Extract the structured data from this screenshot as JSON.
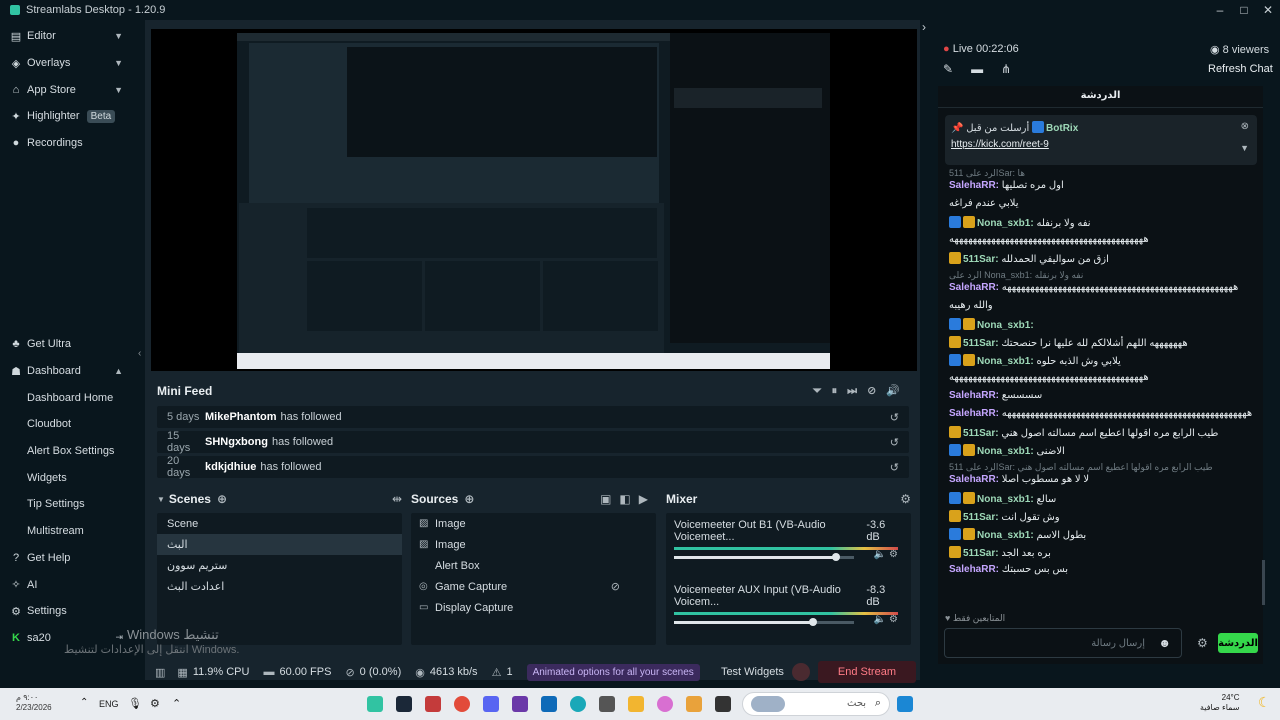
{
  "app": {
    "title": "Streamlabs Desktop - 1.20.9"
  },
  "window": {
    "minimize": "–",
    "maximize": "□",
    "close": "✕"
  },
  "sidebar": {
    "top": [
      {
        "label": "Editor",
        "icon": "editor-icon"
      },
      {
        "label": "Overlays",
        "icon": "overlays-icon"
      },
      {
        "label": "App Store",
        "icon": "app-store-icon"
      },
      {
        "label": "Highlighter",
        "icon": "highlighter-icon",
        "badge": "Beta"
      },
      {
        "label": "Recordings",
        "icon": "recordings-icon"
      }
    ],
    "bottom": [
      {
        "label": "Get Ultra"
      },
      {
        "label": "Dashboard"
      },
      {
        "label": "Dashboard Home"
      },
      {
        "label": "Cloudbot"
      },
      {
        "label": "Alert Box Settings"
      },
      {
        "label": "Widgets"
      },
      {
        "label": "Tip Settings"
      },
      {
        "label": "Multistream"
      },
      {
        "label": "Get Help"
      },
      {
        "label": "AI"
      },
      {
        "label": "Settings"
      },
      {
        "label": "sa20"
      }
    ]
  },
  "minifeed": {
    "title": "Mini Feed",
    "rows": [
      {
        "days": "5 days",
        "name": "MikePhantom",
        "text": "has followed"
      },
      {
        "days": "15 days",
        "name": "SHNgxbong",
        "text": "has followed"
      },
      {
        "days": "20 days",
        "name": "kdkjdhiue",
        "text": "has followed"
      }
    ]
  },
  "scenes": {
    "title": "Scenes",
    "items": [
      "Scene",
      "البث",
      "ستريم سوون",
      "اعدادت البث"
    ],
    "selected": 1
  },
  "sources": {
    "title": "Sources",
    "items": [
      "Image",
      "Image",
      "Alert Box",
      "Game Capture",
      "Display Capture"
    ]
  },
  "mixer": {
    "title": "Mixer",
    "items": [
      {
        "name": "Voicemeeter Out B1 (VB-Audio Voicemeet...",
        "db": "-3.6 dB",
        "level": 0.9
      },
      {
        "name": "Voicemeeter AUX Input (VB-Audio Voicem...",
        "db": "-8.3 dB",
        "level": 0.77
      }
    ]
  },
  "footer": {
    "cpu": "11.9% CPU",
    "fps": "60.00 FPS",
    "dropped": "0 (0.0%)",
    "bitrate": "4613 kb/s",
    "alerts": "1",
    "animated": "Animated options for all your scenes",
    "test_widgets": "Test Widgets",
    "end_stream": "End Stream"
  },
  "chat": {
    "live": "Live 00:22:06",
    "viewers": "8 viewers",
    "refresh": "Refresh Chat",
    "tab": "الدردشة",
    "pinned_by": "أرسلت من قبل",
    "pinned_user": "BotRix",
    "pinned_link": "https://kick.com/reet-9",
    "messages": [
      {
        "reply": "الرد على 511Sar: ها"
      },
      {
        "user": "SalehaRR:",
        "text": "اول مره تصليها"
      },
      {
        "text": "يلابي عندم فراغه"
      },
      {
        "user": "Nona_sxb1:",
        "text": "نفه ولا برنفله",
        "badges": 1
      },
      {
        "text": "ههههههههههههههههههههههههههههههههههههههههههه"
      },
      {
        "user": "511Sar:",
        "text": "ازق من سواليفي الحمدلله",
        "gold": 1
      },
      {
        "reply": "الرد على Nona_sxb1: نفه ولا برنقله"
      },
      {
        "user": "SalehaRR:",
        "text": "ههههههههههههههههههههههههههههههههههههههههههههههههههه"
      },
      {
        "text": "والله رهيبه"
      },
      {
        "user": "Nona_sxb1:",
        "text": "",
        "badges": 1
      },
      {
        "user": "511Sar:",
        "text": "هههههههه اللهم أشلالكم لله عليها نرا حنصحتك",
        "gold": 1
      },
      {
        "user": "Nona_sxb1:",
        "text": "يلابي وش الذبه حلوه",
        "badges": 1
      },
      {
        "text": "ههههههههههههههههههههههههههههههههههههههههههه"
      },
      {
        "user": "SalehaRR:",
        "text": "سسسسع"
      },
      {
        "user": "SalehaRR:",
        "text": "هههههههههههههههههههههههههههههههههههههههههههههههههههههه"
      },
      {
        "user": "511Sar:",
        "text": "طيب الرابع مره اقولها اعطيع اسم مسالته اصول هني",
        "gold": 1
      },
      {
        "user": "Nona_sxb1:",
        "text": "الاضنى",
        "badges": 1
      },
      {
        "reply": "الرد على 511Sar: طيب الرابع مره اقولها اعطيع اسم مسالته اصول هني"
      },
      {
        "user": "SalehaRR:",
        "text": "لا لا هو مسطوب أصلا"
      },
      {
        "user": "Nona_sxb1:",
        "text": "سالع",
        "badges": 1
      },
      {
        "user": "511Sar:",
        "text": "وش تقول انت",
        "gold": 1
      },
      {
        "user": "Nona_sxb1:",
        "text": "بطول الاسم",
        "badges": 1
      },
      {
        "user": "511Sar:",
        "text": "بره بعد الجد",
        "gold": 1
      },
      {
        "user": "SalehaRR:",
        "text": "بس بس حسبتك"
      }
    ],
    "chatters": "المتابعين فقط",
    "input_placeholder": "إرسال رسالة",
    "send": "الدردشة"
  },
  "windows_watermark": {
    "line1": "Windows تنشيط",
    "line2": "انتقل إلى الإعدادات لتنشيط Windows."
  },
  "taskbar": {
    "time": "٩:٠٠ م",
    "date": "2/23/2026",
    "lang": "ENG",
    "search": "بحث",
    "weather_temp": "24°C",
    "weather_text": "سماء صافية"
  }
}
